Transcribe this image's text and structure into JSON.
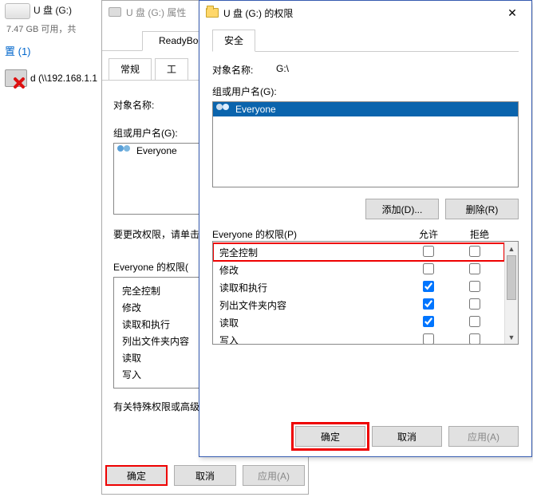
{
  "explorer": {
    "drive_label": "U 盘 (G:)",
    "drive_sub": "7.47 GB 可用，共",
    "location_count": "置 (1)",
    "netdrive_label": "d (\\\\192.168.1.1"
  },
  "props": {
    "title": "U 盘 (G:) 属性",
    "tab_readyboost": "ReadyBoost",
    "tab_general": "常规",
    "tab_tools": "工",
    "object_name_label": "对象名称:",
    "group_users_label": "组或用户名(G):",
    "everyone": "Everyone",
    "change_perm_text": "要更改权限，请单击",
    "perm_for_label": "Everyone 的权限(",
    "perm_items": [
      "完全控制",
      "修改",
      "读取和执行",
      "列出文件夹内容",
      "读取",
      "写入"
    ],
    "special_text": "有关特殊权限或高级",
    "ok": "确定",
    "cancel": "取消",
    "apply": "应用(A)"
  },
  "perm": {
    "title": "U 盘 (G:) 的权限",
    "tab_security": "安全",
    "object_name_label": "对象名称:",
    "object_name_value": "G:\\",
    "group_users_label": "组或用户名(G):",
    "everyone": "Everyone",
    "add_btn": "添加(D)...",
    "remove_btn": "删除(R)",
    "perm_for_label": "Everyone 的权限(P)",
    "col_allow": "允许",
    "col_deny": "拒绝",
    "rows": [
      {
        "name": "完全控制",
        "allow": false,
        "deny": false,
        "hl": true
      },
      {
        "name": "修改",
        "allow": false,
        "deny": false,
        "hl": false
      },
      {
        "name": "读取和执行",
        "allow": true,
        "deny": false,
        "hl": false
      },
      {
        "name": "列出文件夹内容",
        "allow": true,
        "deny": false,
        "hl": false
      },
      {
        "name": "读取",
        "allow": true,
        "deny": false,
        "hl": false
      },
      {
        "name": "写入",
        "allow": false,
        "deny": false,
        "hl": false
      }
    ],
    "ok": "确定",
    "cancel": "取消",
    "apply": "应用(A)"
  }
}
